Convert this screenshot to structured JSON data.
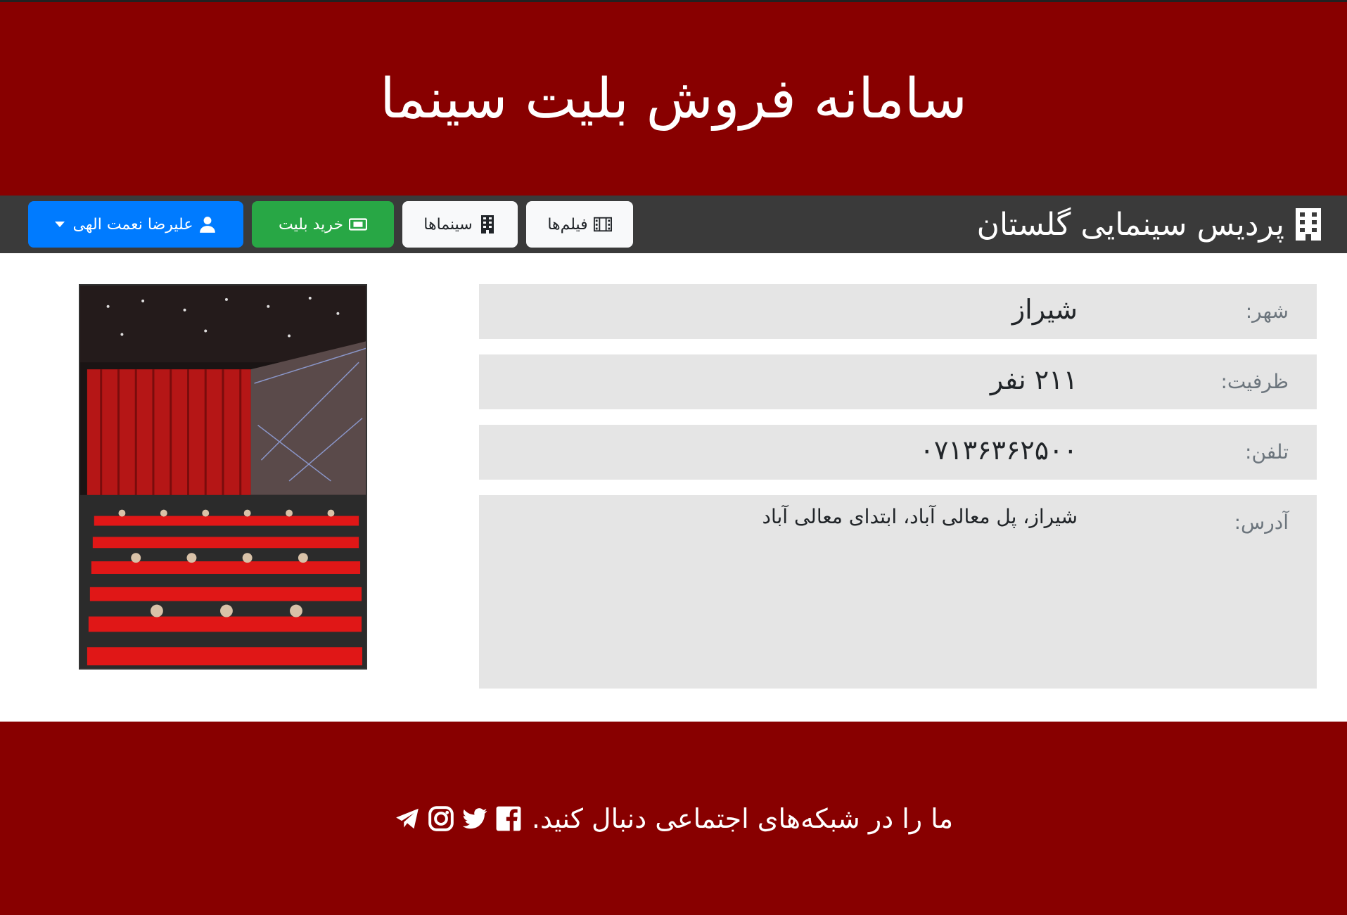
{
  "header": {
    "title": "سامانه فروش بلیت سینما"
  },
  "navbar": {
    "brand": "پردیس سینمایی گلستان",
    "buttons": {
      "films": "فیلم‌ها",
      "cinemas": "سینماها",
      "buy_ticket": "خرید بلیت",
      "user": "علیرضا نعمت الهی"
    }
  },
  "cinema": {
    "city_label": "شهر:",
    "city": "شیراز",
    "capacity_label": "ظرفیت:",
    "capacity": "۲۱۱ نفر",
    "phone_label": "تلفن:",
    "phone": "۰۷۱۳۶۳۶۲۵۰۰",
    "address_label": "آدرس:",
    "address": "شیراز، پل معالی آباد، ابتدای معالی آباد"
  },
  "footer": {
    "text": "ما را در شبکه‌های اجتماعی دنبال کنید.",
    "social_icons": [
      "facebook-icon",
      "twitter-icon",
      "instagram-icon",
      "telegram-icon"
    ]
  },
  "colors": {
    "header_bg": "#880000",
    "navbar_bg": "#3a3a3a",
    "success": "#28a745",
    "primary": "#007bff"
  }
}
